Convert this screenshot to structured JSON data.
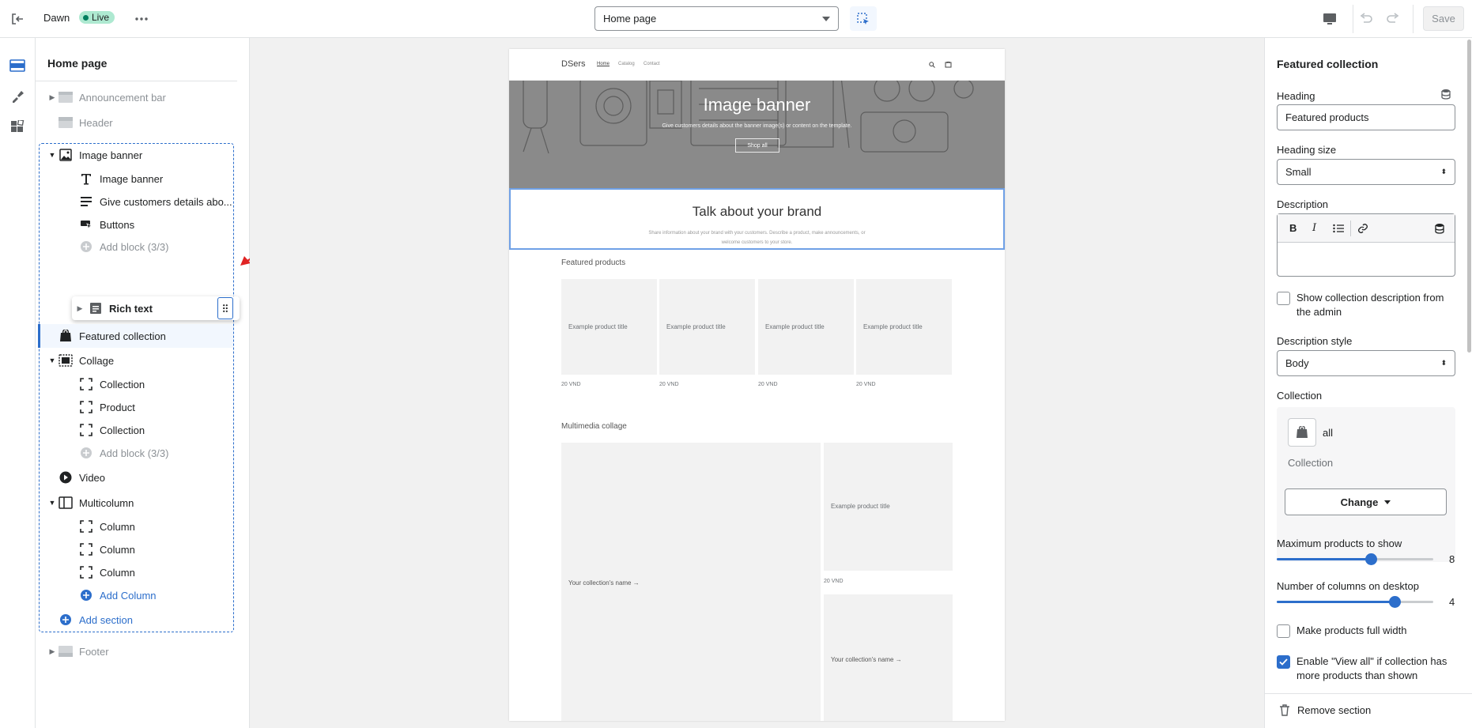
{
  "topbar": {
    "theme_name": "Dawn",
    "live_label": "Live",
    "page_select": "Home page",
    "save_label": "Save"
  },
  "panel": {
    "title": "Home page",
    "items": [
      {
        "label": "Announcement bar"
      },
      {
        "label": "Header"
      },
      {
        "label": "Image banner"
      },
      {
        "label": "Image banner"
      },
      {
        "label": "Give customers details abo..."
      },
      {
        "label": "Buttons"
      },
      {
        "label": "Add block (3/3)"
      },
      {
        "label": "Rich text"
      },
      {
        "label": "Featured collection"
      },
      {
        "label": "Collage"
      },
      {
        "label": "Collection"
      },
      {
        "label": "Product"
      },
      {
        "label": "Collection"
      },
      {
        "label": "Add block (3/3)"
      },
      {
        "label": "Video"
      },
      {
        "label": "Multicolumn"
      },
      {
        "label": "Column"
      },
      {
        "label": "Column"
      },
      {
        "label": "Column"
      },
      {
        "label": "Add Column"
      },
      {
        "label": "Add section"
      },
      {
        "label": "Footer"
      }
    ]
  },
  "preview": {
    "store_name": "DSers",
    "nav": [
      "Home",
      "Catalog",
      "Contact"
    ],
    "banner_title": "Image banner",
    "banner_sub": "Give customers details about the banner image(s) or content on the template.",
    "banner_button": "Shop all",
    "rich_title": "Talk about your brand",
    "rich_text_1": "Share information about your brand with your customers. Describe a product, make announcements, or",
    "rich_text_2": "welcome customers to your store.",
    "featured_heading": "Featured products",
    "product_title": "Example product title",
    "price": "20 VND",
    "collage_heading": "Multimedia collage",
    "collection_name": "Your collection's name →"
  },
  "settings": {
    "title": "Featured collection",
    "heading_label": "Heading",
    "heading_value": "Featured products",
    "heading_size_label": "Heading size",
    "heading_size_value": "Small",
    "description_label": "Description",
    "show_desc_label": "Show collection description from the admin",
    "show_desc_checked": false,
    "desc_style_label": "Description style",
    "desc_style_value": "Body",
    "collection_label": "Collection",
    "collection_name": "all",
    "collection_sub": "Collection",
    "change_label": "Change",
    "max_products_label": "Maximum products to show",
    "max_products_value": "8",
    "max_products_fraction": 0.6,
    "columns_label": "Number of columns on desktop",
    "columns_value": "4",
    "columns_fraction": 0.75,
    "full_width_label": "Make products full width",
    "full_width_checked": false,
    "view_all_label": "Enable \"View all\" if collection has more products than shown",
    "view_all_checked": true,
    "remove_label": "Remove section"
  },
  "colors": {
    "accent": "#2c6ecb",
    "live_badge": "#aee9d1",
    "banner_bg": "#8a8a8a"
  }
}
